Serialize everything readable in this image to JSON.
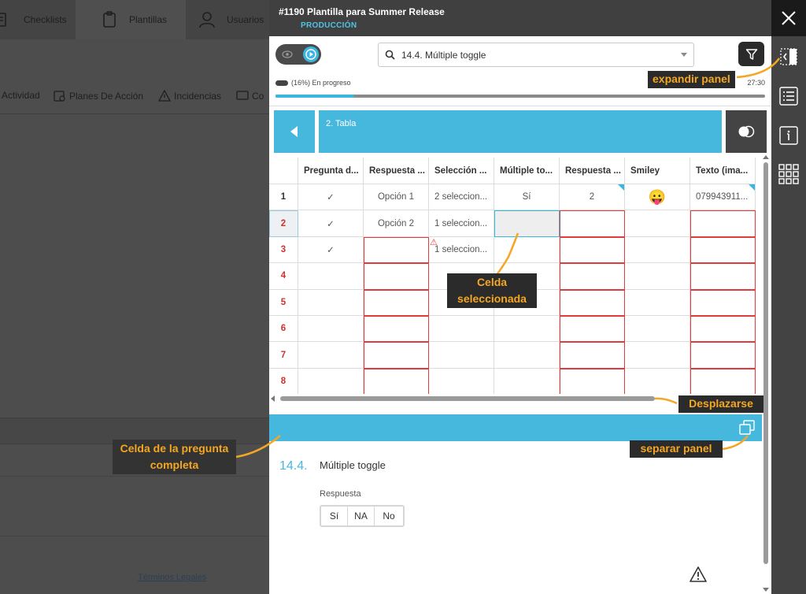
{
  "background": {
    "nav": [
      {
        "label": "Checklists",
        "icon": "checklist-icon"
      },
      {
        "label": "Plantillas",
        "icon": "clipboard-icon"
      },
      {
        "label": "Usuarios",
        "icon": "user-icon"
      }
    ],
    "subnav": [
      {
        "label": "Actividad",
        "icon": ""
      },
      {
        "label": "Planes De Acción",
        "icon": "action-plan-icon"
      },
      {
        "label": "Incidencias",
        "icon": "warning-icon"
      },
      {
        "label": "Co",
        "icon": "chat-icon"
      }
    ],
    "legal_link": "Términos Legales"
  },
  "panel": {
    "title": "#1190 Plantilla para Summer Release",
    "subtitle": "PRODUCCIÓN",
    "search_value": "14.4. Múltiple toggle",
    "progress": {
      "label": "(16%) En progreso",
      "percent": 16,
      "time": "27:30"
    },
    "section_title": "2.  Tabla",
    "table": {
      "headers": [
        "Pregunta d...",
        "Respuesta ...",
        "Selección ...",
        "Múltiple to...",
        "Respuesta ...",
        "Smiley",
        "Texto (ima..."
      ],
      "rows": [
        {
          "num": "1",
          "cells": [
            "✓",
            "Opción 1",
            "2 seleccion...",
            "Sí",
            "2",
            "😛",
            "079943911..."
          ]
        },
        {
          "num": "2",
          "cells": [
            "✓",
            "Opción 2",
            "1 seleccion...",
            "",
            "",
            "",
            ""
          ]
        },
        {
          "num": "3",
          "cells": [
            "✓",
            "",
            "1 seleccion...",
            "",
            "",
            "",
            ""
          ]
        },
        {
          "num": "4",
          "cells": [
            "",
            "",
            "",
            "",
            "",
            "",
            ""
          ]
        },
        {
          "num": "5",
          "cells": [
            "",
            "",
            "",
            "",
            "",
            "",
            ""
          ]
        },
        {
          "num": "6",
          "cells": [
            "",
            "",
            "",
            "",
            "",
            "",
            ""
          ]
        },
        {
          "num": "7",
          "cells": [
            "",
            "",
            "",
            "",
            "",
            "",
            ""
          ]
        },
        {
          "num": "8",
          "cells": [
            "",
            "",
            "",
            "",
            "",
            "",
            ""
          ]
        }
      ]
    },
    "question": {
      "number": "14.4.",
      "text": "Múltiple toggle",
      "answer_label": "Respuesta",
      "options": [
        "Sí",
        "NA",
        "No"
      ]
    }
  },
  "annotations": {
    "expand_panel": "expandir panel",
    "selected_cell_1": "Celda",
    "selected_cell_2": "seleccionada",
    "scroll": "Desplazarse",
    "full_question_1": "Celda de la pregunta",
    "full_question_2": "completa",
    "detach_panel": "separar panel"
  },
  "colors": {
    "accent": "#47b8dd",
    "error": "#e23b3b",
    "annotation_text": "#f5a623",
    "annotation_bg": "#2b2b2b"
  }
}
